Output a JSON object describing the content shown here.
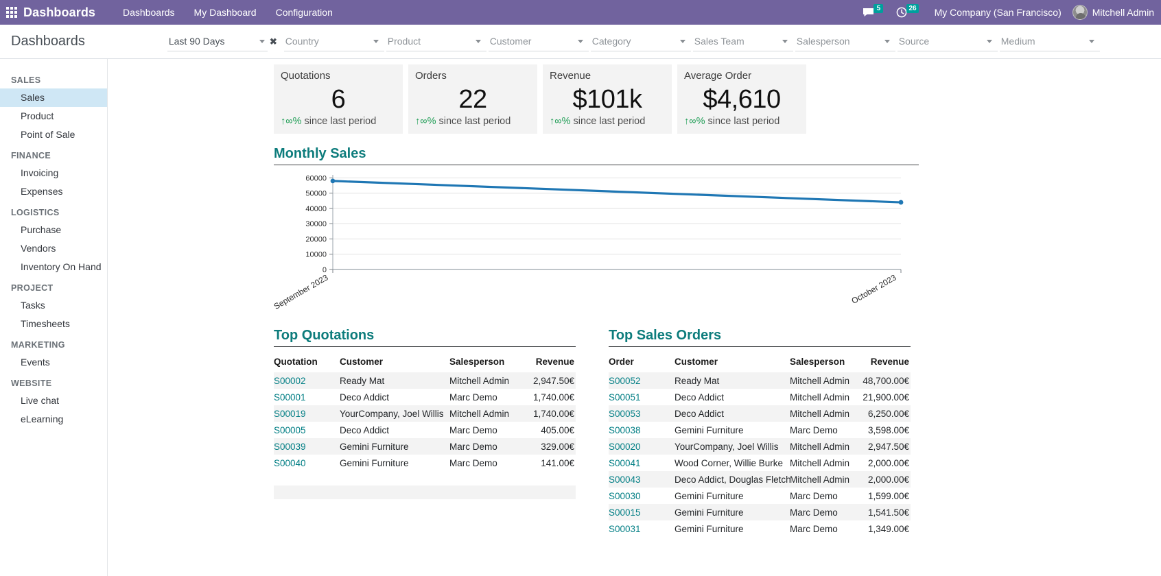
{
  "navbar": {
    "apps_icon": "apps-grid-icon",
    "brand": "Dashboards",
    "menu": [
      {
        "label": "Dashboards"
      },
      {
        "label": "My Dashboard"
      },
      {
        "label": "Configuration"
      }
    ],
    "messages_icon": "chat-bubble-icon",
    "messages_count": "5",
    "activities_icon": "clock-icon",
    "activities_count": "26",
    "company": "My Company (San Francisco)",
    "user": "Mitchell Admin",
    "avatar_icon": "user-avatar",
    "accent_color": "#71639e",
    "badge_color": "#00a09d"
  },
  "controlbar": {
    "page_title": "Dashboards",
    "active_filter": {
      "label": "Last 90 Days",
      "remove_icon": "close-icon"
    },
    "filters": [
      {
        "label": "Country"
      },
      {
        "label": "Product"
      },
      {
        "label": "Customer"
      },
      {
        "label": "Category"
      },
      {
        "label": "Sales Team"
      },
      {
        "label": "Salesperson"
      },
      {
        "label": "Source"
      },
      {
        "label": "Medium"
      }
    ]
  },
  "sidebar": {
    "groups": [
      {
        "label": "SALES",
        "items": [
          {
            "label": "Sales",
            "selected": true
          },
          {
            "label": "Product",
            "selected": false
          },
          {
            "label": "Point of Sale",
            "selected": false
          }
        ]
      },
      {
        "label": "FINANCE",
        "items": [
          {
            "label": "Invoicing",
            "selected": false
          },
          {
            "label": "Expenses",
            "selected": false
          }
        ]
      },
      {
        "label": "LOGISTICS",
        "items": [
          {
            "label": "Purchase",
            "selected": false
          },
          {
            "label": "Vendors",
            "selected": false
          },
          {
            "label": "Inventory On Hand",
            "selected": false
          }
        ]
      },
      {
        "label": "PROJECT",
        "items": [
          {
            "label": "Tasks",
            "selected": false
          },
          {
            "label": "Timesheets",
            "selected": false
          }
        ]
      },
      {
        "label": "MARKETING",
        "items": [
          {
            "label": "Events",
            "selected": false
          }
        ]
      },
      {
        "label": "WEBSITE",
        "items": [
          {
            "label": "Live chat",
            "selected": false
          },
          {
            "label": "eLearning",
            "selected": false
          }
        ]
      }
    ]
  },
  "kpis": [
    {
      "label": "Quotations",
      "value": "6",
      "arrow": "↑",
      "pct": "∞%",
      "delta_suffix": "since last period"
    },
    {
      "label": "Orders",
      "value": "22",
      "arrow": "↑",
      "pct": "∞%",
      "delta_suffix": "since last period"
    },
    {
      "label": "Revenue",
      "value": "$101k",
      "arrow": "↑",
      "pct": "∞%",
      "delta_suffix": "since last period"
    },
    {
      "label": "Average Order",
      "value": "$4,610",
      "arrow": "↑",
      "pct": "∞%",
      "delta_suffix": "since last period"
    }
  ],
  "chart_section": {
    "title": "Monthly Sales"
  },
  "chart_data": {
    "type": "line",
    "title": "Monthly Sales",
    "xlabel": "",
    "ylabel": "",
    "categories": [
      "September 2023",
      "October 2023"
    ],
    "x": [
      "September 2023",
      "October 2023"
    ],
    "series": [
      {
        "name": "Monthly Sales",
        "values": [
          58000,
          44000
        ],
        "color": "#1f77b4"
      }
    ],
    "values": [
      58000,
      44000
    ],
    "yticks": [
      0,
      10000,
      20000,
      30000,
      40000,
      50000,
      60000
    ],
    "ytick_labels": [
      "0",
      "10000",
      "20000",
      "30000",
      "40000",
      "50000",
      "60000"
    ],
    "ylim": [
      0,
      62000
    ],
    "grid": true,
    "legend": false,
    "xtick_rotation": -30,
    "line_color": "#1f77b4",
    "marker": "circle"
  },
  "top_quotations": {
    "title": "Top Quotations",
    "columns": [
      "Quotation",
      "Customer",
      "Salesperson",
      "Revenue"
    ],
    "rows": [
      {
        "ref": "S00002",
        "customer": "Ready Mat",
        "salesperson": "Mitchell Admin",
        "revenue": "2,947.50€"
      },
      {
        "ref": "S00001",
        "customer": "Deco Addict",
        "salesperson": "Marc Demo",
        "revenue": "1,740.00€"
      },
      {
        "ref": "S00019",
        "customer": "YourCompany, Joel Willis",
        "salesperson": "Mitchell Admin",
        "revenue": "1,740.00€"
      },
      {
        "ref": "S00005",
        "customer": "Deco Addict",
        "salesperson": "Marc Demo",
        "revenue": "405.00€"
      },
      {
        "ref": "S00039",
        "customer": "Gemini Furniture",
        "salesperson": "Marc Demo",
        "revenue": "329.00€"
      },
      {
        "ref": "S00040",
        "customer": "Gemini Furniture",
        "salesperson": "Marc Demo",
        "revenue": "141.00€"
      }
    ]
  },
  "top_sales_orders": {
    "title": "Top Sales Orders",
    "columns": [
      "Order",
      "Customer",
      "Salesperson",
      "Revenue"
    ],
    "rows": [
      {
        "ref": "S00052",
        "customer": "Ready Mat",
        "salesperson": "Mitchell Admin",
        "revenue": "48,700.00€"
      },
      {
        "ref": "S00051",
        "customer": "Deco Addict",
        "salesperson": "Mitchell Admin",
        "revenue": "21,900.00€"
      },
      {
        "ref": "S00053",
        "customer": "Deco Addict",
        "salesperson": "Mitchell Admin",
        "revenue": "6,250.00€"
      },
      {
        "ref": "S00038",
        "customer": "Gemini Furniture",
        "salesperson": "Marc Demo",
        "revenue": "3,598.00€"
      },
      {
        "ref": "S00020",
        "customer": "YourCompany, Joel Willis",
        "salesperson": "Mitchell Admin",
        "revenue": "2,947.50€"
      },
      {
        "ref": "S00041",
        "customer": "Wood Corner, Willie Burke",
        "salesperson": "Mitchell Admin",
        "revenue": "2,000.00€"
      },
      {
        "ref": "S00043",
        "customer": "Deco Addict, Douglas Fletche",
        "salesperson": "Mitchell Admin",
        "revenue": "2,000.00€"
      },
      {
        "ref": "S00030",
        "customer": "Gemini Furniture",
        "salesperson": "Marc Demo",
        "revenue": "1,599.00€"
      },
      {
        "ref": "S00015",
        "customer": "Gemini Furniture",
        "salesperson": "Marc Demo",
        "revenue": "1,541.50€"
      },
      {
        "ref": "S00031",
        "customer": "Gemini Furniture",
        "salesperson": "Marc Demo",
        "revenue": "1,349.00€"
      }
    ]
  }
}
